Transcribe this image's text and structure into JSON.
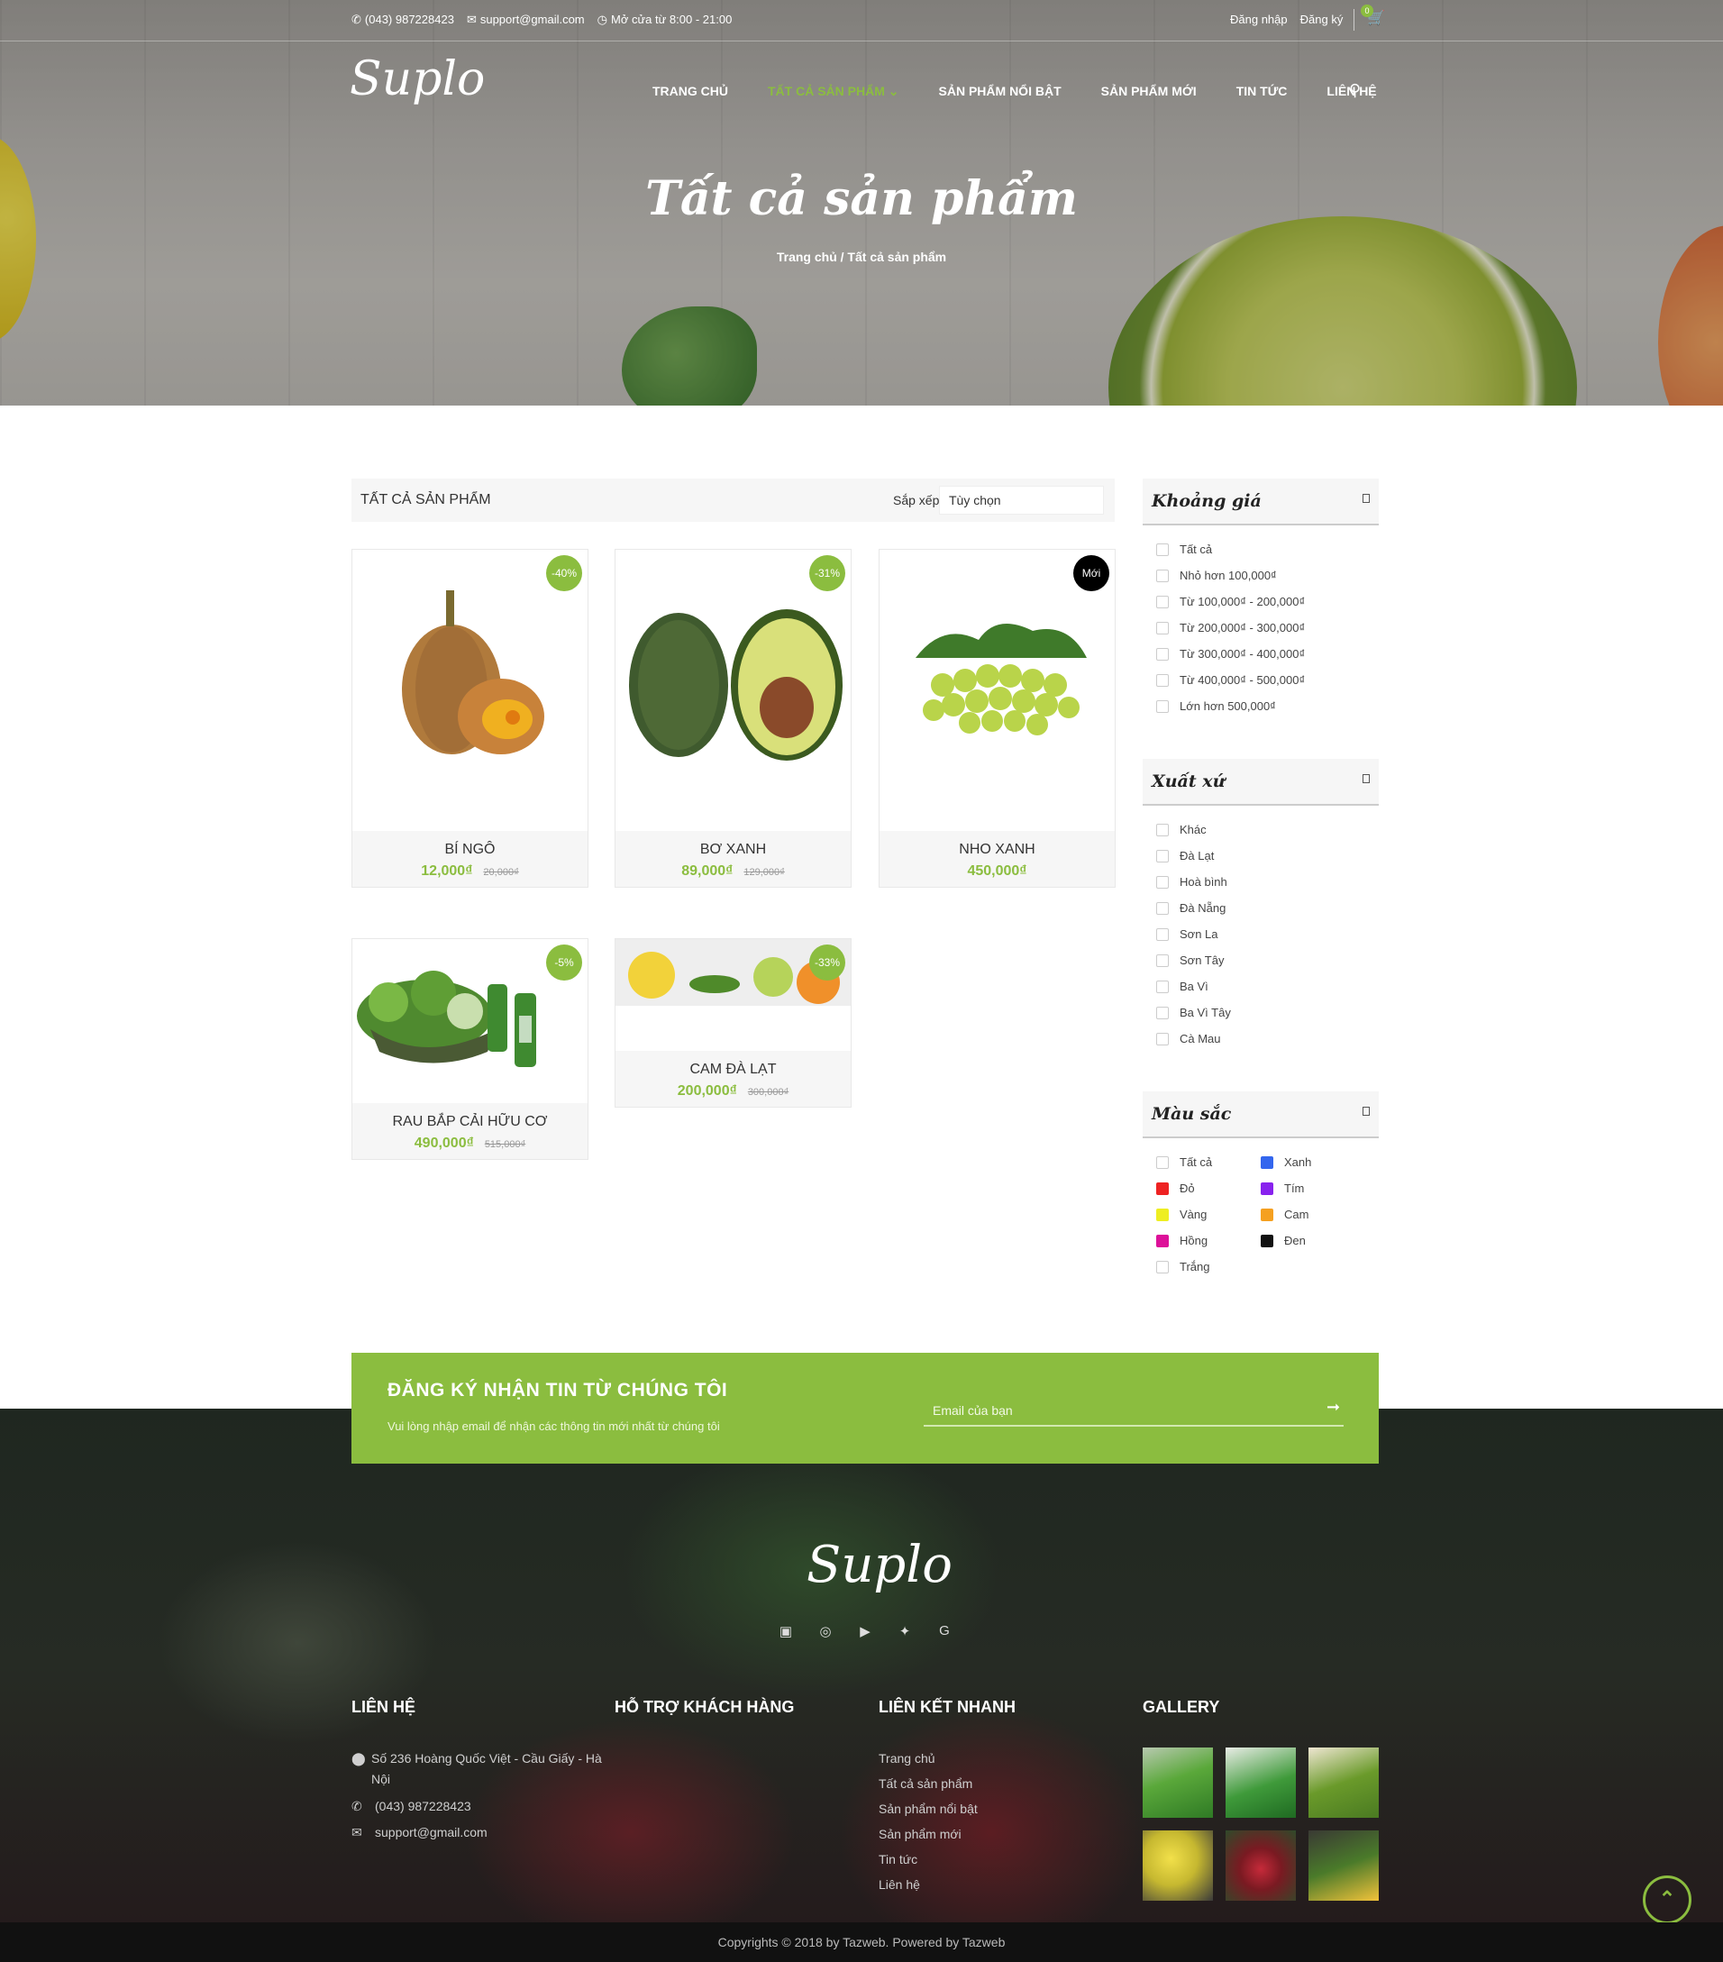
{
  "topbar": {
    "phone": "(043) 987228423",
    "email": "support@gmail.com",
    "hours": "Mở cửa từ 8:00 - 21:00",
    "login": "Đăng nhập",
    "register": "Đăng ký",
    "cart_count": "0"
  },
  "brand": {
    "logo": "Suplo"
  },
  "nav": {
    "items": [
      "TRANG CHỦ",
      "TẤT CẢ SẢN PHẨM",
      "SẢN PHẨM NỔI BẬT",
      "SẢN PHẨM MỚI",
      "TIN TỨC",
      "LIÊN HỆ"
    ],
    "active_index": 1
  },
  "hero": {
    "title": "Tất cả sản phẩm",
    "breadcrumb": "Trang chủ / Tất cả sản phẩm"
  },
  "listing": {
    "title": "TẤT CẢ SẢN PHẨM",
    "sort_label": "Sắp xếp",
    "sort_value": "Tùy chọn"
  },
  "products": [
    {
      "name": "BÍ NGÔ",
      "price": "12,000₫",
      "old_price": "20,000₫",
      "badge": "-40%"
    },
    {
      "name": "BƠ XANH",
      "price": "89,000₫",
      "old_price": "129,000₫",
      "badge": "-31%"
    },
    {
      "name": "NHO XANH",
      "price": "450,000₫",
      "old_price": "",
      "badge": "Mới"
    },
    {
      "name": "RAU BẮP CẢI HỮU CƠ",
      "price": "490,000₫",
      "old_price": "515,000₫",
      "badge": "-5%"
    },
    {
      "name": "CAM ĐÀ LẠT",
      "price": "200,000₫",
      "old_price": "300,000₫",
      "badge": "-33%"
    }
  ],
  "filters": {
    "price": {
      "title": "Khoảng giá",
      "options": [
        "Tất cả",
        "Nhỏ hơn 100,000₫",
        "Từ 100,000₫ - 200,000₫",
        "Từ 200,000₫ - 300,000₫",
        "Từ 300,000₫ - 400,000₫",
        "Từ 400,000₫ - 500,000₫",
        "Lớn hơn 500,000₫"
      ]
    },
    "origin": {
      "title": "Xuất xứ",
      "options": [
        "Khác",
        "Đà Lạt",
        "Hoà bình",
        "Đà Nẵng",
        "Sơn La",
        "Sơn Tây",
        "Ba Vì",
        "Ba Vì Tây",
        "Cà Mau"
      ]
    },
    "color": {
      "title": "Màu sắc",
      "options": [
        {
          "label": "Tất cả",
          "color": ""
        },
        {
          "label": "Xanh",
          "color": "#3366ee"
        },
        {
          "label": "Đỏ",
          "color": "#ee2222"
        },
        {
          "label": "Tím",
          "color": "#8822ee"
        },
        {
          "label": "Vàng",
          "color": "#eeee22"
        },
        {
          "label": "Cam",
          "color": "#f5a020"
        },
        {
          "label": "Hồng",
          "color": "#dd1199"
        },
        {
          "label": "Đen",
          "color": "#111111"
        },
        {
          "label": "Trắng",
          "color": ""
        }
      ]
    }
  },
  "newsletter": {
    "title": "ĐĂNG KÝ NHẬN TIN TỪ CHÚNG TÔI",
    "subtitle": "Vui lòng nhập email để nhận các thông tin mới nhất từ chúng tôi",
    "placeholder": "Email của bạn"
  },
  "footer": {
    "logo": "Suplo",
    "social_icons": [
      "facebook-icon",
      "instagram-icon",
      "youtube-icon",
      "twitter-icon",
      "google-plus-icon"
    ],
    "contact": {
      "title": "LIÊN HỆ",
      "address_line1": "Số 236 Hoàng Quốc Việt - Cầu Giấy - Hà",
      "address_line2": "Nội",
      "phone": "(043) 987228423",
      "email": "support@gmail.com"
    },
    "support": {
      "title": "HỖ TRỢ KHÁCH HÀNG"
    },
    "quicklinks": {
      "title": "LIÊN KẾT NHANH",
      "items": [
        "Trang chủ",
        "Tất cả sản phẩm",
        "Sản phẩm nổi bật",
        "Sản phẩm mới",
        "Tin tức",
        "Liên hệ"
      ]
    },
    "gallery": {
      "title": "GALLERY"
    },
    "copyright": "Copyrights © 2018 by Tazweb. Powered by Tazweb"
  },
  "colors": {
    "accent": "#8bbd3f",
    "dark": "#111111"
  }
}
